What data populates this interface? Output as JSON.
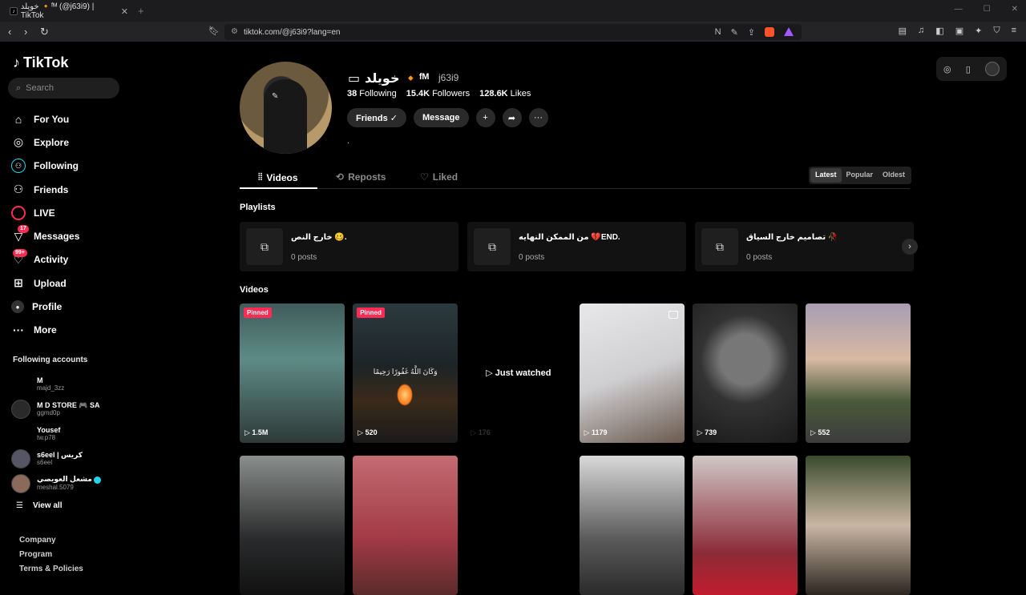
{
  "browser": {
    "tab_title": "خويلد 🔸ᶠᴹ (@j63i9) | TikTok",
    "url": "tiktok.com/@j63i9?lang=en"
  },
  "sidebar": {
    "logo": "TikTok",
    "search_placeholder": "Search",
    "nav": [
      {
        "label": "For You",
        "icon": "home-icon"
      },
      {
        "label": "Explore",
        "icon": "compass-icon"
      },
      {
        "label": "Following",
        "icon": "following-icon"
      },
      {
        "label": "Friends",
        "icon": "friends-icon"
      },
      {
        "label": "LIVE",
        "icon": "live-icon"
      },
      {
        "label": "Messages",
        "icon": "messages-icon",
        "badge": "17"
      },
      {
        "label": "Activity",
        "icon": "activity-icon",
        "badge": "99+"
      },
      {
        "label": "Upload",
        "icon": "upload-icon"
      },
      {
        "label": "Profile",
        "icon": "profile-icon"
      },
      {
        "label": "More",
        "icon": "more-icon"
      }
    ],
    "following_title": "Following accounts",
    "accounts": [
      {
        "name": "M",
        "user": "majd_3zz"
      },
      {
        "name": "M D STORE 🎮 SA",
        "user": "ggmd0p"
      },
      {
        "name": "Yousef",
        "user": "tw.p78"
      },
      {
        "name": "s6eel | كريس",
        "user": "s6eel"
      },
      {
        "name": "مشعل العويصي",
        "user": "meshal.5079",
        "verified": true
      }
    ],
    "view_all": "View all",
    "footer": [
      "Company",
      "Program",
      "Terms & Policies"
    ]
  },
  "profile": {
    "display_name": "خويلد 🔸ᶠᴹ",
    "username": "j63i9",
    "following_count": "38",
    "following_label": "Following",
    "followers_count": "15.4K",
    "followers_label": "Followers",
    "likes_count": "128.6K",
    "likes_label": "Likes",
    "friends_button": "Friends ✓",
    "message_button": "Message",
    "bio": "."
  },
  "tabs": {
    "videos": "Videos",
    "reposts": "Reposts",
    "liked": "Liked"
  },
  "sort": {
    "latest": "Latest",
    "popular": "Popular",
    "oldest": "Oldest",
    "selected": "Latest"
  },
  "playlists_title": "Playlists",
  "playlists": [
    {
      "title": "خارج النص 🥴.",
      "count": "0 posts"
    },
    {
      "title": "من الممكن النهايه 💔END.",
      "count": "0 posts"
    },
    {
      "title": "تصاميم خارج السياق 🥀",
      "count": "0 posts"
    }
  ],
  "videos_title": "Videos",
  "videos": [
    {
      "views": "1.5M",
      "pinned": "Pinned"
    },
    {
      "views": "520",
      "pinned": "Pinned",
      "overlay": "وَكَانَ اللَّهُ غَفُورًا رَحِيمًا"
    },
    {
      "views": "176",
      "status": "Just watched"
    },
    {
      "views": "1179",
      "photo": true
    },
    {
      "views": "739"
    },
    {
      "views": "552"
    },
    {
      "views": ""
    },
    {
      "views": ""
    },
    {
      "views": ""
    },
    {
      "views": ""
    },
    {
      "views": ""
    },
    {
      "views": ""
    }
  ],
  "colors": {
    "accent": "#fe2c55",
    "verified": "#20d5ec",
    "background": "#000000"
  }
}
